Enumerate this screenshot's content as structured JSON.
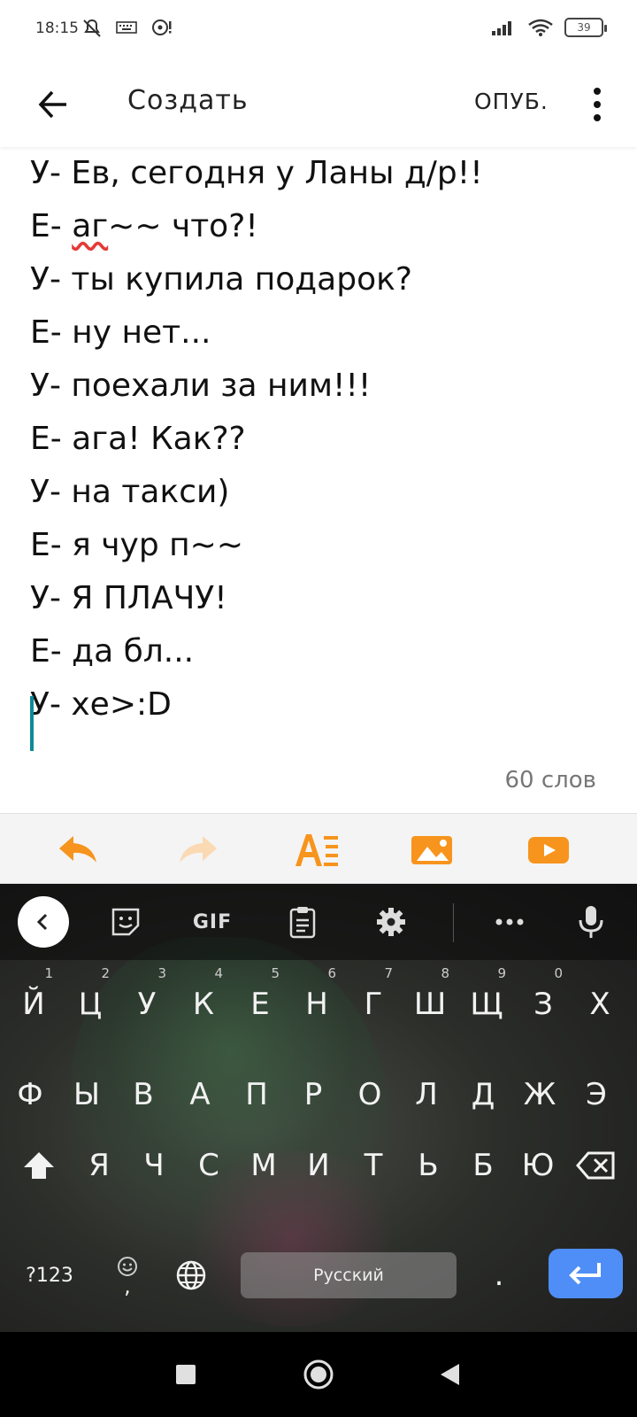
{
  "status_bar": {
    "time": "18:15",
    "battery": "39"
  },
  "app_bar": {
    "title": "Создать",
    "publish_label": "ОПУБ."
  },
  "editor": {
    "lines": [
      "У- Ев, сегодня у Ланы д/р!!",
      {
        "prefix": "Е- ",
        "misspelled": "аг",
        "suffix": "~~ что?!"
      },
      "У- ты купила подарок?",
      "Е- ну нет...",
      "У- поехали за ним!!!",
      "Е- ага! Как??",
      "У- на такси)",
      "Е- я чур п~~",
      "У- Я ПЛАЧУ!",
      "Е- да бл...",
      "У- хе>:D"
    ],
    "word_count": "60 слов"
  },
  "toolbar": {
    "accent_color": "#f7941d",
    "tools": [
      "undo-icon",
      "redo-icon",
      "text-format-icon",
      "image-icon",
      "video-icon"
    ]
  },
  "keyboard": {
    "gif_label": "GIF",
    "row1": [
      {
        "k": "Й",
        "n": "1"
      },
      {
        "k": "Ц",
        "n": "2"
      },
      {
        "k": "У",
        "n": "3"
      },
      {
        "k": "К",
        "n": "4"
      },
      {
        "k": "Е",
        "n": "5"
      },
      {
        "k": "Н",
        "n": "6"
      },
      {
        "k": "Г",
        "n": "7"
      },
      {
        "k": "Ш",
        "n": "8"
      },
      {
        "k": "Щ",
        "n": "9"
      },
      {
        "k": "З",
        "n": "0"
      },
      {
        "k": "Х",
        "n": ""
      }
    ],
    "row2": [
      "Ф",
      "Ы",
      "В",
      "А",
      "П",
      "Р",
      "О",
      "Л",
      "Д",
      "Ж",
      "Э"
    ],
    "row3": [
      "Я",
      "Ч",
      "С",
      "М",
      "И",
      "Т",
      "Ь",
      "Б",
      "Ю"
    ],
    "symbols_label": "?123",
    "comma": ",",
    "space_label": "Русский",
    "period": "."
  }
}
